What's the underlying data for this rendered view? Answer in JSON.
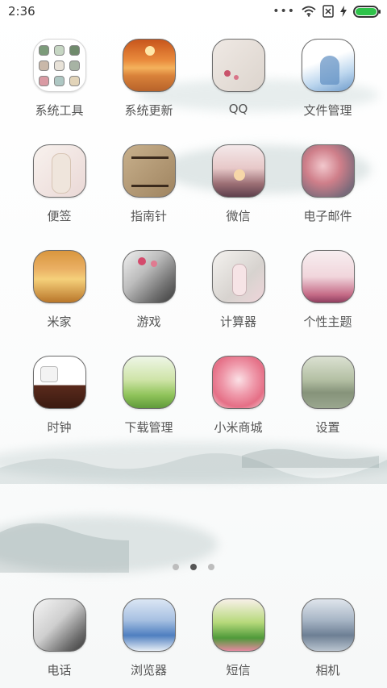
{
  "status_bar": {
    "time": "2:36"
  },
  "page_indicator": {
    "count": 3,
    "active_index": 1
  },
  "apps": [
    {
      "label": "系统工具",
      "icon": "folder-icon"
    },
    {
      "label": "系统更新",
      "icon": "sunset-lake-icon"
    },
    {
      "label": "QQ",
      "icon": "qq-icon"
    },
    {
      "label": "文件管理",
      "icon": "file-manager-icon"
    },
    {
      "label": "便签",
      "icon": "notes-icon"
    },
    {
      "label": "指南针",
      "icon": "compass-icon"
    },
    {
      "label": "微信",
      "icon": "wechat-icon"
    },
    {
      "label": "电子邮件",
      "icon": "email-icon"
    },
    {
      "label": "米家",
      "icon": "mijia-icon"
    },
    {
      "label": "游戏",
      "icon": "games-icon"
    },
    {
      "label": "计算器",
      "icon": "calculator-icon"
    },
    {
      "label": "个性主题",
      "icon": "themes-icon"
    },
    {
      "label": "时钟",
      "icon": "clock-icon"
    },
    {
      "label": "下载管理",
      "icon": "downloads-icon"
    },
    {
      "label": "小米商城",
      "icon": "mi-store-icon"
    },
    {
      "label": "设置",
      "icon": "settings-icon"
    }
  ],
  "dock": [
    {
      "label": "电话",
      "icon": "phone-icon"
    },
    {
      "label": "浏览器",
      "icon": "browser-icon"
    },
    {
      "label": "短信",
      "icon": "messages-icon"
    },
    {
      "label": "相机",
      "icon": "camera-icon"
    }
  ]
}
